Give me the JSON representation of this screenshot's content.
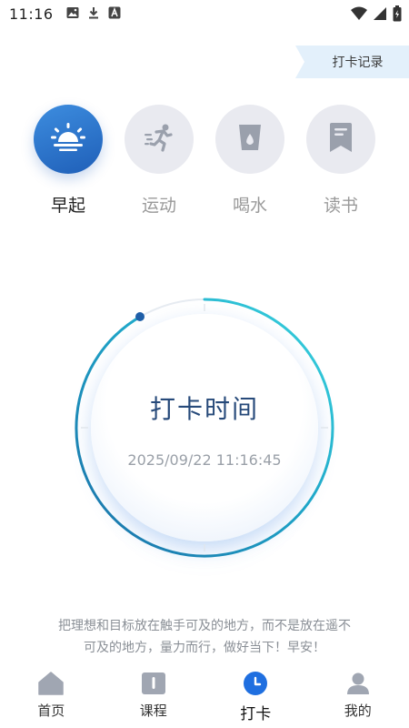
{
  "status_bar": {
    "time": "11:16"
  },
  "record_tag": {
    "label": "打卡记录"
  },
  "categories": [
    {
      "label": "早起",
      "icon": "sunrise-icon",
      "active": true
    },
    {
      "label": "运动",
      "icon": "running-icon",
      "active": false
    },
    {
      "label": "喝水",
      "icon": "water-cup-icon",
      "active": false
    },
    {
      "label": "读书",
      "icon": "bookmark-book-icon",
      "active": false
    }
  ],
  "clock": {
    "title": "打卡时间",
    "datetime": "2025/09/22 11:16:45"
  },
  "motto": {
    "line1": "把理想和目标放在触手可及的地方，而不是放在遥不",
    "line2": "可及的地方，量力而行，做好当下！早安！"
  },
  "bottom_nav": [
    {
      "label": "首页",
      "icon": "home-icon",
      "active": false
    },
    {
      "label": "课程",
      "icon": "course-book-icon",
      "active": false
    },
    {
      "label": "打卡",
      "icon": "clock-icon",
      "active": true
    },
    {
      "label": "我的",
      "icon": "profile-icon",
      "active": false
    }
  ],
  "colors": {
    "accent": "#1f5fb8",
    "ring_start": "#1a7fb0",
    "ring_end": "#3ad6e0",
    "inactive_icon": "#9aa0ac"
  }
}
